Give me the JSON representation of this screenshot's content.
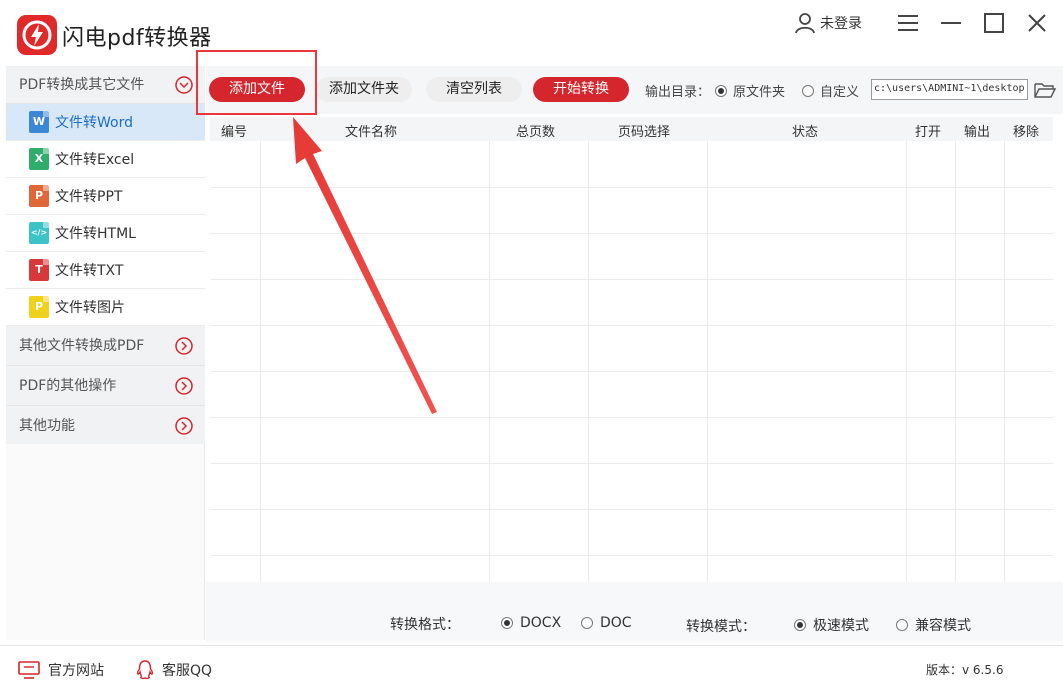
{
  "app": {
    "title": "闪电pdf转换器",
    "user_label": "未登录",
    "colors": {
      "brand_red": "#d4262c",
      "active_blue": "#1b6fc7",
      "active_bg": "#d8e8f8"
    }
  },
  "sidebar": {
    "section_title": "PDF转换成其它文件",
    "items": [
      {
        "label": "文件转Word",
        "icon": "word-file-icon",
        "glyph": "W",
        "color": "#3b87d6"
      },
      {
        "label": "文件转Excel",
        "icon": "excel-file-icon",
        "glyph": "X",
        "color": "#2fae6b"
      },
      {
        "label": "文件转PPT",
        "icon": "ppt-file-icon",
        "glyph": "P",
        "color": "#e0673a"
      },
      {
        "label": "文件转HTML",
        "icon": "html-file-icon",
        "glyph": "</>",
        "color": "#3cc3c8"
      },
      {
        "label": "文件转TXT",
        "icon": "txt-file-icon",
        "glyph": "T",
        "color": "#d9383b"
      },
      {
        "label": "文件转图片",
        "icon": "image-file-icon",
        "glyph": "P",
        "color": "#f0d21c"
      }
    ],
    "groups": [
      {
        "label": "其他文件转换成PDF"
      },
      {
        "label": "PDF的其他操作"
      },
      {
        "label": "其他功能"
      }
    ]
  },
  "toolbar": {
    "add_file": "添加文件",
    "add_folder": "添加文件夹",
    "clear_list": "清空列表",
    "start_convert": "开始转换",
    "output_dir_label": "输出目录：",
    "option_original": "原文件夹",
    "option_custom": "自定义",
    "output_path": "c:\\users\\ADMINI~1\\desktop"
  },
  "table": {
    "columns": [
      "编号",
      "文件名称",
      "总页数",
      "页码选择",
      "状态",
      "打开",
      "输出",
      "移除"
    ]
  },
  "options": {
    "format_label": "转换格式：",
    "format_options": [
      "DOCX",
      "DOC"
    ],
    "format_selected": "DOCX",
    "mode_label": "转换模式：",
    "mode_options": [
      "极速模式",
      "兼容模式"
    ],
    "mode_selected": "极速模式"
  },
  "footer": {
    "website": "官方网站",
    "qq": "客服QQ",
    "version": "版本：v 6.5.6"
  }
}
